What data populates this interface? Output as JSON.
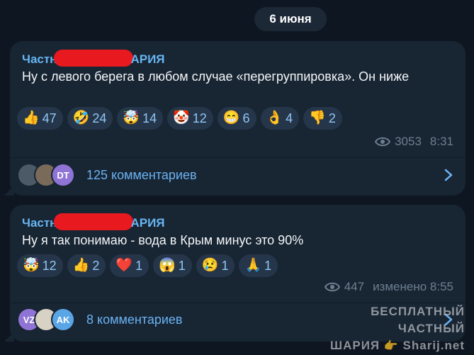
{
  "date": "6 июня",
  "messages": [
    {
      "author_prefix": "Частн",
      "author_suffix": "АРИЯ",
      "text": "Ну с левого берега в любом случае «перегруппировка». Он ниже",
      "reactions": [
        {
          "emoji": "👍",
          "count": "47"
        },
        {
          "emoji": "🤣",
          "count": "24"
        },
        {
          "emoji": "🤯",
          "count": "14"
        },
        {
          "emoji": "🤡",
          "count": "12"
        },
        {
          "emoji": "😁",
          "count": "6"
        },
        {
          "emoji": "👌",
          "count": "4"
        },
        {
          "emoji": "👎",
          "count": "2"
        }
      ],
      "views": "3053",
      "time": "8:31",
      "comments": "125 комментариев",
      "avatars": [
        {
          "label": "",
          "color": "#4b5a66"
        },
        {
          "label": "",
          "color": "#7a6a5a"
        },
        {
          "label": "DT",
          "color": "#8f74d6"
        }
      ]
    },
    {
      "author_prefix": "Частн",
      "author_suffix": "АРИЯ",
      "text": "Ну я так понимаю - вода в Крым минус это 90%",
      "reactions": [
        {
          "emoji": "🤯",
          "count": "12"
        },
        {
          "emoji": "👍",
          "count": "2"
        },
        {
          "emoji": "❤️",
          "count": "1"
        },
        {
          "emoji": "😱",
          "count": "1"
        },
        {
          "emoji": "😢",
          "count": "1"
        },
        {
          "emoji": "🙏",
          "count": "1"
        }
      ],
      "views": "447",
      "time": "изменено 8:55",
      "comments": "8 комментариев",
      "avatars": [
        {
          "label": "VZ",
          "color": "#8f74d6"
        },
        {
          "label": "",
          "color": "#d8d2c4"
        },
        {
          "label": "AK",
          "color": "#5aa5e6"
        }
      ]
    }
  ],
  "watermark": {
    "line1": "БЕСПЛАТНЫЙ ЧАСТНЫЙ",
    "line2": "ШАРИЯ",
    "site": "Sharij.net"
  },
  "icons": {
    "views": "eye-icon",
    "open": "chevron-right-icon"
  },
  "colors": {
    "background": "#0e1621",
    "bubble": "#182533",
    "accent": "#6ab2f2",
    "redaction": "#e8191f"
  }
}
